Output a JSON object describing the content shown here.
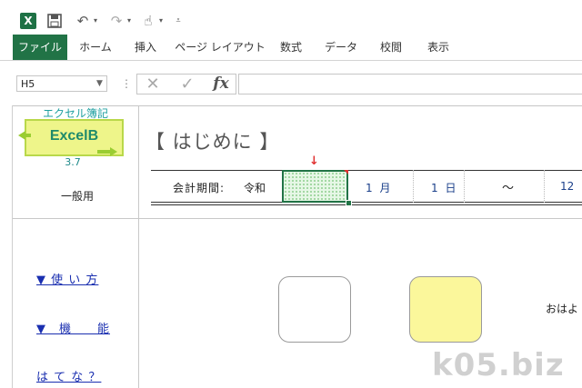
{
  "app": {
    "app_icon": "excel-icon",
    "app_icon_glyph": "X",
    "quick_access": {
      "save_icon": "save-icon",
      "undo_icon": "undo-icon",
      "redo_icon": "redo-icon",
      "touch_icon": "touch-mode-icon",
      "customize_icon": "customize-qat-icon"
    }
  },
  "ribbon": {
    "tabs": [
      {
        "label": "ファイル"
      },
      {
        "label": "ホーム"
      },
      {
        "label": "挿入"
      },
      {
        "label": "ページ レイアウト"
      },
      {
        "label": "数式"
      },
      {
        "label": "データ"
      },
      {
        "label": "校閲"
      },
      {
        "label": "表示"
      }
    ],
    "file_tab_color": "#217346"
  },
  "formula_bar": {
    "name_box": "H5",
    "fx_label": "fx",
    "formula": ""
  },
  "sheet": {
    "logo": {
      "caption": "エクセル簿記",
      "name": "ExcelB",
      "version": "3.7"
    },
    "edition": "一般用",
    "heading": "【 はじめに 】",
    "period": {
      "label": "会計期間:",
      "era": "令和",
      "selected_cell_value": "",
      "month_value": "1",
      "month_unit": "月",
      "day_value": "1",
      "day_unit": "日",
      "separator": "～",
      "end_value": "12"
    },
    "links": [
      {
        "label": "▼ 使 い 方"
      },
      {
        "label": "▼　機　　能"
      },
      {
        "label": "は て な ？"
      }
    ],
    "greeting": "おはよ",
    "colors": {
      "selection": "#217346",
      "link": "#1a2fb0",
      "logo_fill": "#eef58a",
      "yellow_button": "#fbf79b"
    }
  },
  "watermark": "k05.biz"
}
